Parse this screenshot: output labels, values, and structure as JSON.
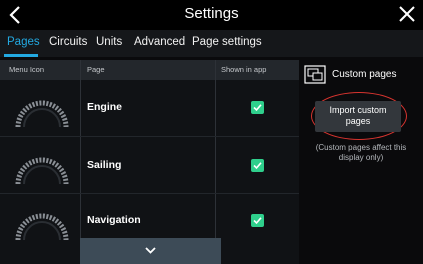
{
  "header": {
    "title": "Settings",
    "back_icon": "chevron-left-icon",
    "close_icon": "close-icon"
  },
  "tabs": [
    {
      "label": "Pages",
      "active": true
    },
    {
      "label": "Circuits",
      "active": false
    },
    {
      "label": "Units",
      "active": false
    },
    {
      "label": "Advanced",
      "active": false
    },
    {
      "label": "Page settings",
      "active": false
    }
  ],
  "table": {
    "columns": [
      "Menu Icon",
      "Page",
      "Shown in app"
    ],
    "rows": [
      {
        "page": "Engine",
        "shown_in_app": true,
        "icon": "gauge-icon"
      },
      {
        "page": "Sailing",
        "shown_in_app": true,
        "icon": "gauge-icon"
      },
      {
        "page": "Navigation",
        "shown_in_app": true,
        "icon": "gauge-icon"
      }
    ],
    "scroll_icon": "chevron-down-icon"
  },
  "side": {
    "custom_pages_label": "Custom pages",
    "custom_pages_icon": "custom-pages-icon",
    "import_button_line1": "Import custom",
    "import_button_line2": "pages",
    "note_line1": "(Custom pages affect this",
    "note_line2": "display only)"
  },
  "colors": {
    "accent": "#23a9e1",
    "checkbox": "#2fcf8c",
    "highlight": "#d8342f"
  }
}
